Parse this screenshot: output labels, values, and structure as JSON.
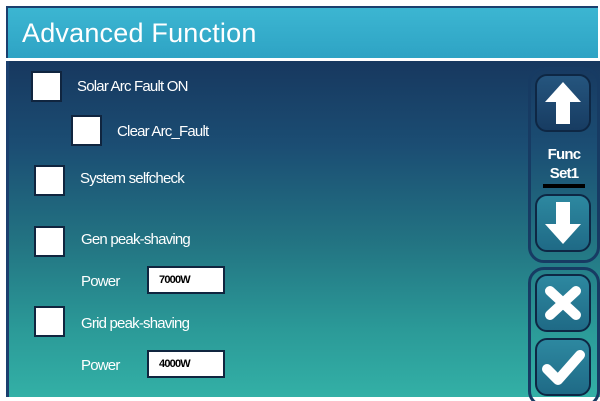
{
  "header": {
    "title": "Advanced Function"
  },
  "options": {
    "solar_arc_fault": {
      "label": "Solar Arc Fault ON",
      "checked": false
    },
    "clear_arc_fault": {
      "label": "Clear Arc_Fault",
      "checked": false
    },
    "system_selfcheck": {
      "label": "System selfcheck",
      "checked": false
    },
    "gen_peak_shaving": {
      "label": "Gen peak-shaving",
      "checked": false,
      "power_label": "Power",
      "power_value": "7000W"
    },
    "grid_peak_shaving": {
      "label": "Grid peak-shaving",
      "checked": false,
      "power_label": "Power",
      "power_value": "4000W"
    }
  },
  "side": {
    "func_label_line1": "Func",
    "func_label_line2": "Set1",
    "icons": {
      "up": "arrow-up-icon",
      "down": "arrow-down-icon",
      "cancel": "close-icon",
      "confirm": "check-icon"
    }
  },
  "colors": {
    "header": "#36afcd",
    "panel_top": "#17385f",
    "panel_bottom": "#33b0a6",
    "border": "#1b3f6e"
  }
}
